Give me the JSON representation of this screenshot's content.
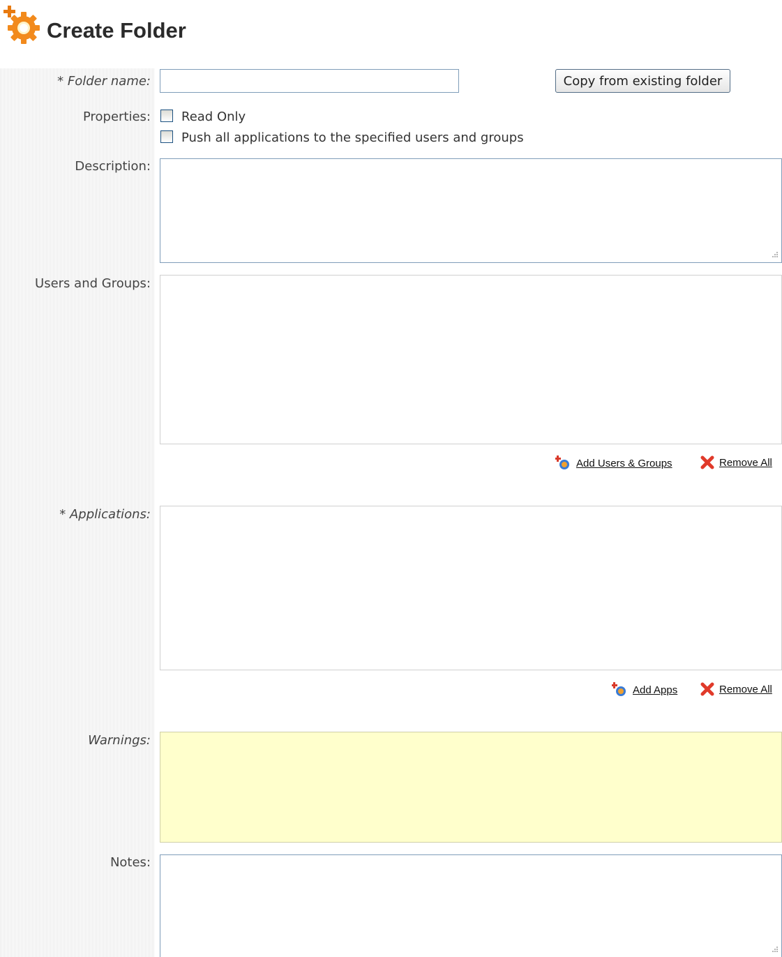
{
  "header": {
    "title": "Create Folder",
    "icon": "create-folder-gear-icon",
    "accent": "#f28a1c"
  },
  "form": {
    "folder_name_label": "* Folder name:",
    "folder_name_value": "",
    "copy_button_label": "Copy from existing folder",
    "properties_label": "Properties:",
    "checkboxes": [
      {
        "label": "Read Only",
        "checked": false
      },
      {
        "label": "Push all applications to the specified users and groups",
        "checked": false
      }
    ],
    "description_label": "Description:",
    "description_value": "",
    "users_groups_label": "Users and Groups:",
    "add_users_groups_label": "Add Users & Groups",
    "remove_all_users_label": "Remove All",
    "applications_label": "* Applications:",
    "add_apps_label": "Add Apps",
    "remove_all_apps_label": "Remove All",
    "warnings_label": "Warnings:",
    "warnings_bg": "#ffffcc",
    "notes_label": "Notes:",
    "notes_value": ""
  }
}
